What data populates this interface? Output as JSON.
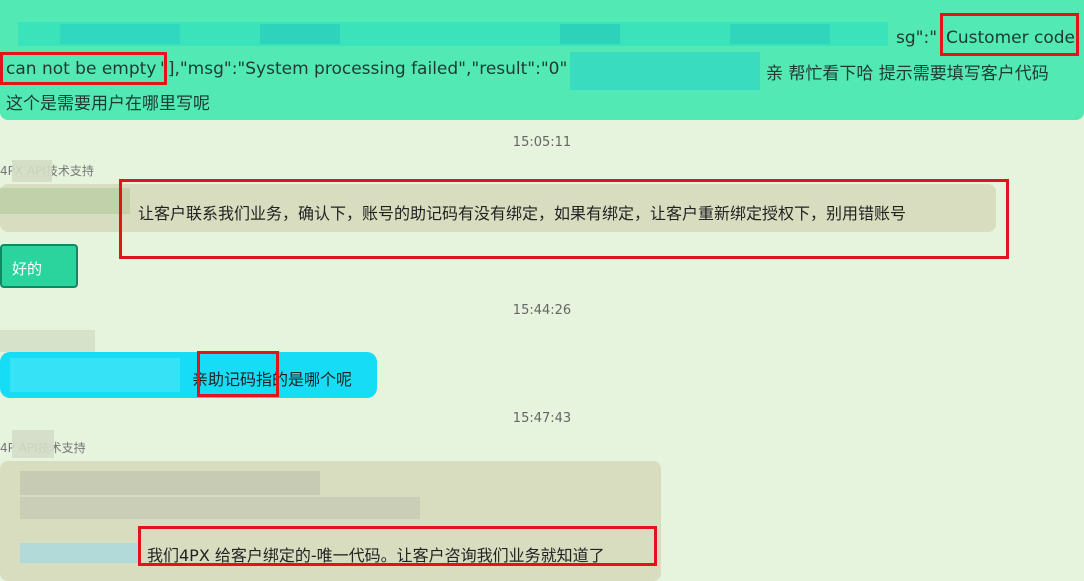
{
  "top_message": {
    "line1_tail_prefix": "sg\":\"",
    "line1_highlight": "Customer code",
    "line2_highlight": "can not be empty",
    "line2_middle": "\"],\"msg\":\"System processing failed\",\"result\":\"0\"",
    "line2_tail": "亲  帮忙看下哈  提示需要填写客户代码",
    "line3": "这个是需要用户在哪里写呢"
  },
  "timestamps": [
    "15:05:11",
    "15:44:26",
    "15:47:43"
  ],
  "sender_name_1": "4PX      API技术支持",
  "reply_1": "让客户联系我们业务，确认下，账号的助记码有没有绑定，如果有绑定，让客户重新绑定授权下，别用错账号",
  "sticker_label": "好的",
  "user_msg_2": {
    "prefix": "亲",
    "highlight": "助记码指",
    "suffix": "的是哪个呢"
  },
  "sender_name_2": "4P      API技术支持",
  "reply_2": "我们4PX 给客户绑定的-唯一代码。让客户咨询我们业务就知道了",
  "colors": {
    "top_bubble": "#52e9b5",
    "page_bg": "#e6f3dd",
    "gray_bubble": "#d8ddbf",
    "cyan_bubble": "#16dcf5",
    "highlight_border": "#e0141a"
  }
}
